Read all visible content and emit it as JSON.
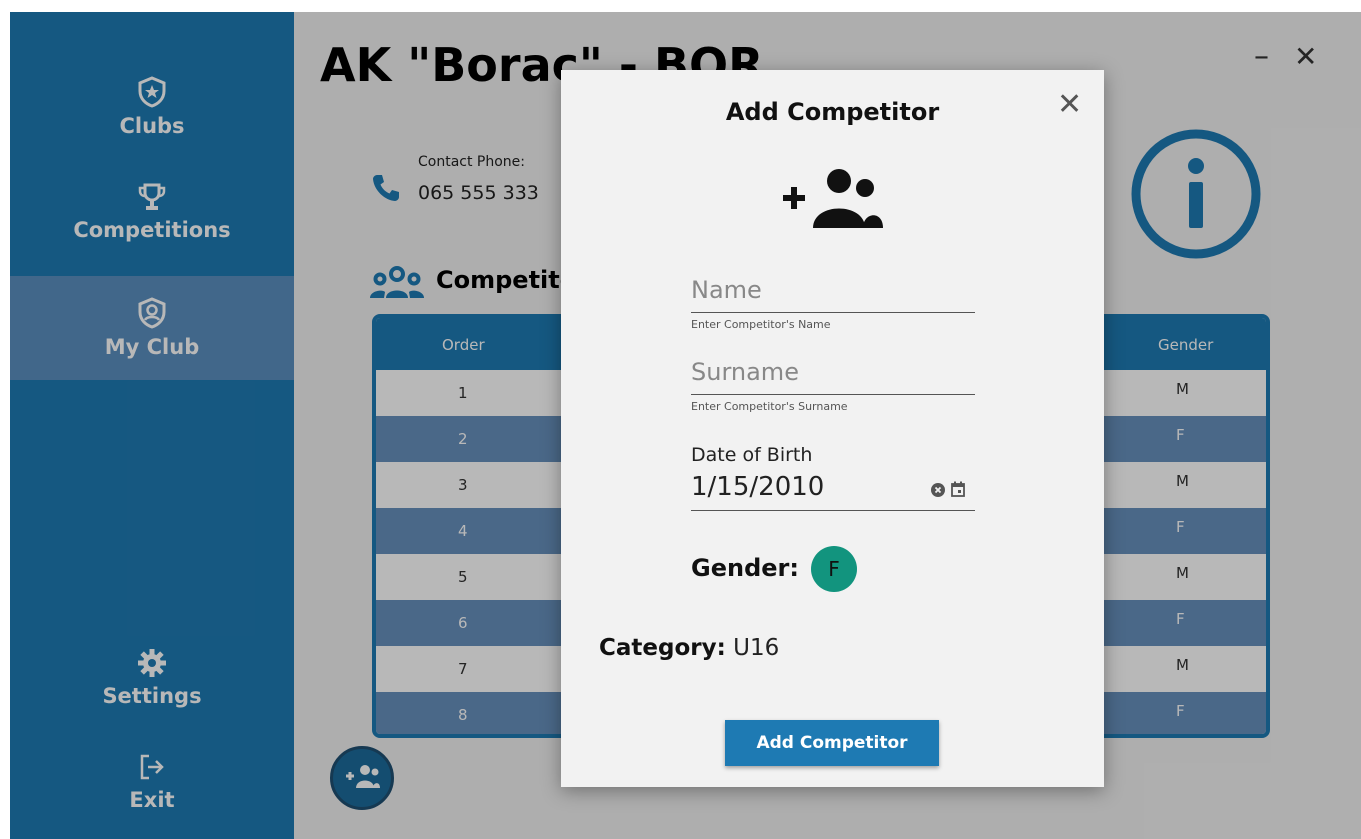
{
  "sidebar": {
    "items": [
      {
        "label": "Clubs",
        "icon": "shield-star-icon"
      },
      {
        "label": "Competitions",
        "icon": "trophy-icon"
      },
      {
        "label": "My Club",
        "icon": "shield-user-icon"
      },
      {
        "label": "Settings",
        "icon": "gear-icon"
      },
      {
        "label": "Exit",
        "icon": "exit-icon"
      }
    ],
    "active": "My Club"
  },
  "header": {
    "club_title": "AK \"Borac\" - BOR",
    "minimize": "–",
    "close": "✕"
  },
  "contact": {
    "label": "Contact Phone:",
    "value": "065 555 333"
  },
  "section": {
    "title": "Competitors"
  },
  "table": {
    "columns": {
      "order": "Order",
      "gender": "Gender"
    },
    "rows": [
      {
        "order": "1",
        "gender": "M"
      },
      {
        "order": "2",
        "gender": "F"
      },
      {
        "order": "3",
        "gender": "M"
      },
      {
        "order": "4",
        "gender": "F"
      },
      {
        "order": "5",
        "gender": "M"
      },
      {
        "order": "6",
        "gender": "F"
      },
      {
        "order": "7",
        "gender": "M"
      },
      {
        "order": "8",
        "gender": "F"
      }
    ]
  },
  "dialog": {
    "title": "Add Competitor",
    "close": "✕",
    "name": {
      "placeholder": "Name",
      "hint": "Enter Competitor's Name"
    },
    "surname": {
      "placeholder": "Surname",
      "hint": "Enter Competitor's Surname"
    },
    "dob": {
      "label": "Date of Birth",
      "value": "1/15/2010"
    },
    "gender": {
      "label": "Gender:",
      "value": "F"
    },
    "category": {
      "label": "Category:",
      "value": "U16"
    },
    "submit": "Add Competitor"
  },
  "colors": {
    "accent": "#1e7ab3",
    "sidebar_active": "#5a8fc0",
    "row_alt": "#6790bd",
    "gender_toggle": "#12947e"
  }
}
